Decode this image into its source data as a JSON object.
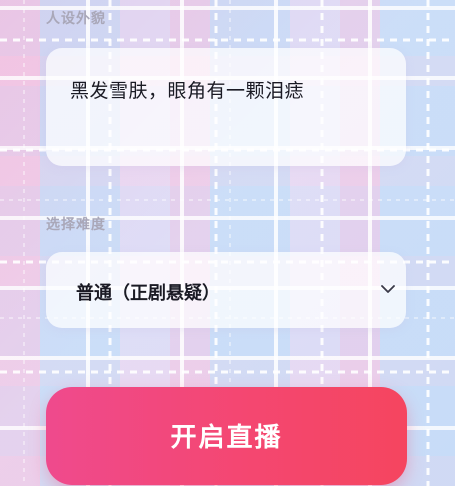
{
  "form": {
    "appearance": {
      "label": "人设外貌",
      "value": "黑发雪肤，眼角有一颗泪痣"
    },
    "difficulty": {
      "label": "选择难度",
      "selected": "普通（正剧悬疑）"
    },
    "start_button_label": "开启直播"
  },
  "colors": {
    "button_gradient_start": "#ef4a8d",
    "button_gradient_end": "#f5455f",
    "label_text": "#a9a7b8",
    "value_text": "#1a1a24"
  },
  "icons": {
    "dropdown": "chevron-down-icon"
  }
}
